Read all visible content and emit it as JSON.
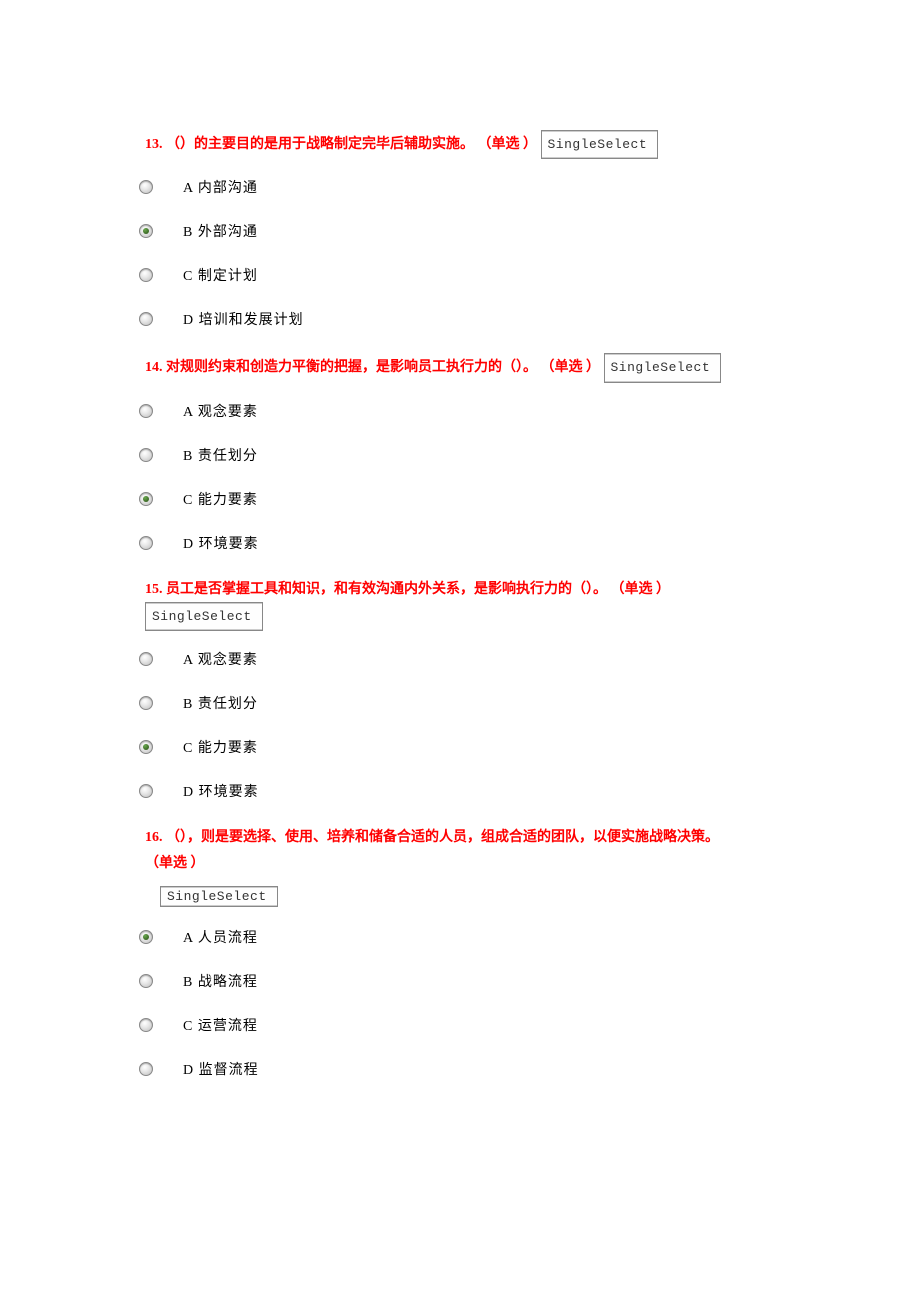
{
  "tag_label": "SingleSelect",
  "questions": [
    {
      "num": "13.",
      "text": "（）的主要目的是用于战略制定完毕后辅助实施。",
      "type_label": "（单选 ）",
      "tag_inline": true,
      "selected": 1,
      "options": [
        "A 内部沟通",
        "B 外部沟通",
        "C 制定计划",
        "D 培训和发展计划"
      ]
    },
    {
      "num": "14.",
      "text": "对规则约束和创造力平衡的把握，是影响员工执行力的（）。",
      "type_label": "（单选 ）",
      "tag_inline": true,
      "selected": 2,
      "options": [
        "A 观念要素",
        "B 责任划分",
        "C 能力要素",
        "D 环境要素"
      ]
    },
    {
      "num": "15.",
      "text": "员工是否掌握工具和知识，和有效沟通内外关系，是影响执行力的（）。",
      "type_label": "（单选 ）",
      "tag_inline": true,
      "selected": 2,
      "options": [
        "A 观念要素",
        "B 责任划分",
        "C 能力要素",
        "D 环境要素"
      ]
    },
    {
      "num": "16.",
      "text": "（），则是要选择、使用、培养和储备合适的人员，组成合适的团队，以便实施战略决策。",
      "type_label": "（单选 ）",
      "tag_inline": false,
      "selected": 0,
      "options": [
        "A 人员流程",
        "B 战略流程",
        "C 运营流程",
        "D 监督流程"
      ]
    }
  ]
}
